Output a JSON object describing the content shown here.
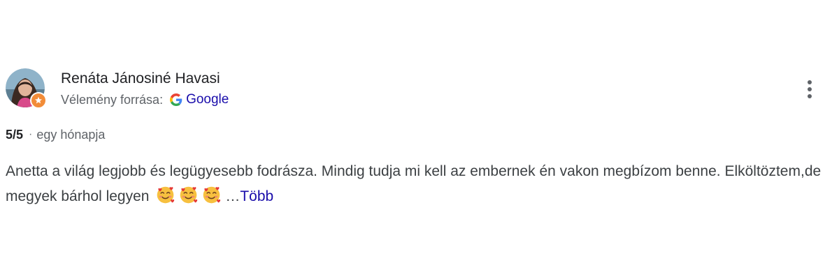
{
  "review": {
    "reviewer_name": "Renáta Jánosiné Havasi",
    "source_label": "Vélemény forrása:",
    "source_name": "Google",
    "rating": "5/5",
    "separator": "·",
    "time_ago": "egy hónapja",
    "text_main": "Anetta a világ legjobb és legügyesebb fodrásza. Mindig tudja mi kell az embernek én vakon megbízom benne. Elköltöztem,de megyek bárhol legyen",
    "emojis": [
      "smiling-face-with-hearts",
      "smiling-face-with-hearts",
      "smiling-face-with-hearts"
    ],
    "ellipsis": "…",
    "more_label": "Több",
    "icons": {
      "avatar": "avatar",
      "badge": "local-guide-badge-icon",
      "google": "google-g-icon",
      "menu": "more-vert-icon"
    },
    "colors": {
      "link": "#1a0dab",
      "badge": "#f28c38",
      "text": "#3c4043"
    }
  }
}
